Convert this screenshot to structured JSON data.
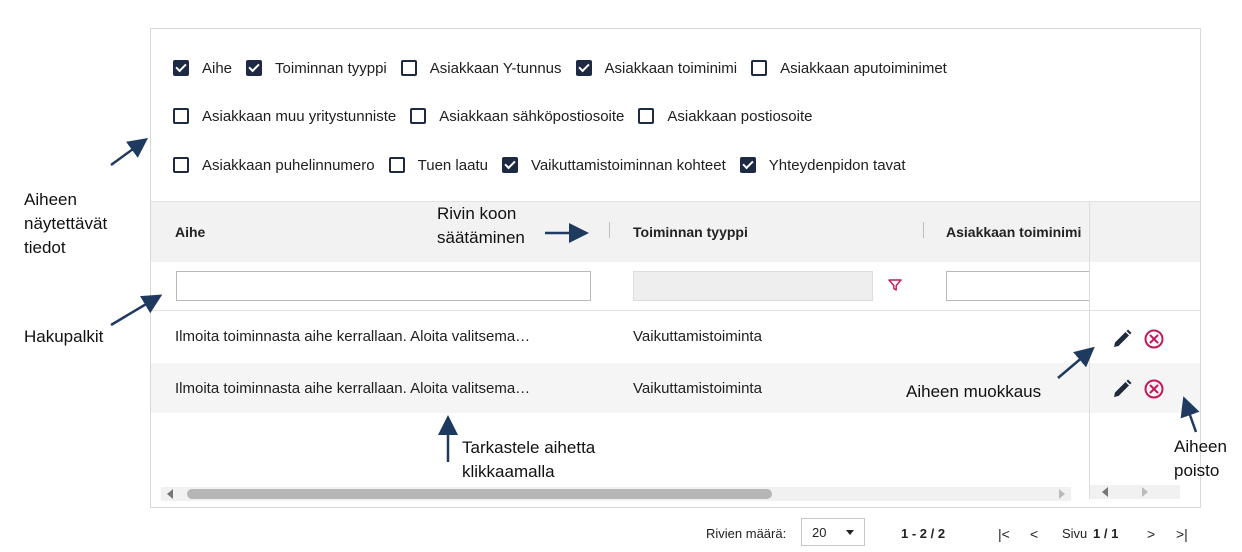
{
  "checkboxes": {
    "row1": [
      {
        "label": "Aihe",
        "checked": true
      },
      {
        "label": "Toiminnan tyyppi",
        "checked": true
      },
      {
        "label": "Asiakkaan Y-tunnus",
        "checked": false
      },
      {
        "label": "Asiakkaan toiminimi",
        "checked": true
      },
      {
        "label": "Asiakkaan aputoiminimet",
        "checked": false
      }
    ],
    "row2": [
      {
        "label": "Asiakkaan muu yritystunniste",
        "checked": false
      },
      {
        "label": "Asiakkaan sähköpostiosoite",
        "checked": false
      },
      {
        "label": "Asiakkaan postiosoite",
        "checked": false
      }
    ],
    "row3": [
      {
        "label": "Asiakkaan puhelinnumero",
        "checked": false
      },
      {
        "label": "Tuen laatu",
        "checked": false
      },
      {
        "label": "Vaikuttamistoiminnan kohteet",
        "checked": true
      },
      {
        "label": "Yhteydenpidon tavat",
        "checked": true
      }
    ]
  },
  "grid": {
    "columns": [
      "Aihe",
      "Toiminnan tyyppi",
      "Asiakkaan toiminimi"
    ],
    "rows": [
      {
        "aihe": "Ilmoita toiminnasta aihe kerrallaan. Aloita valitsema…",
        "tyyppi": "Vaikuttamistoiminta"
      },
      {
        "aihe": "Ilmoita toiminnasta aihe kerrallaan. Aloita valitsema…",
        "tyyppi": "Vaikuttamistoiminta"
      }
    ]
  },
  "pagination": {
    "rows_label": "Rivien määrä:",
    "page_size": "20",
    "range": "1 - 2 / 2",
    "page_label": "Sivu",
    "page_value": "1 / 1"
  },
  "annotations": {
    "shown_fields_1": "Aiheen",
    "shown_fields_2": "näytettävät",
    "shown_fields_3": "tiedot",
    "search_bars": "Hakupalkit",
    "row_size_1": "Rivin koon",
    "row_size_2": "säätäminen",
    "view_1": "Tarkastele aihetta",
    "view_2": "klikkaamalla",
    "edit": "Aiheen muokkaus",
    "delete_1": "Aiheen",
    "delete_2": "poisto"
  },
  "colors": {
    "checkbox": "#1e2a44",
    "delete_icon": "#c2185b",
    "filter_icon": "#c2185b",
    "arrow": "#1e3a5f"
  },
  "icons": {
    "edit": "pencil-icon",
    "delete": "close-circle-icon",
    "filter": "filter-icon"
  }
}
